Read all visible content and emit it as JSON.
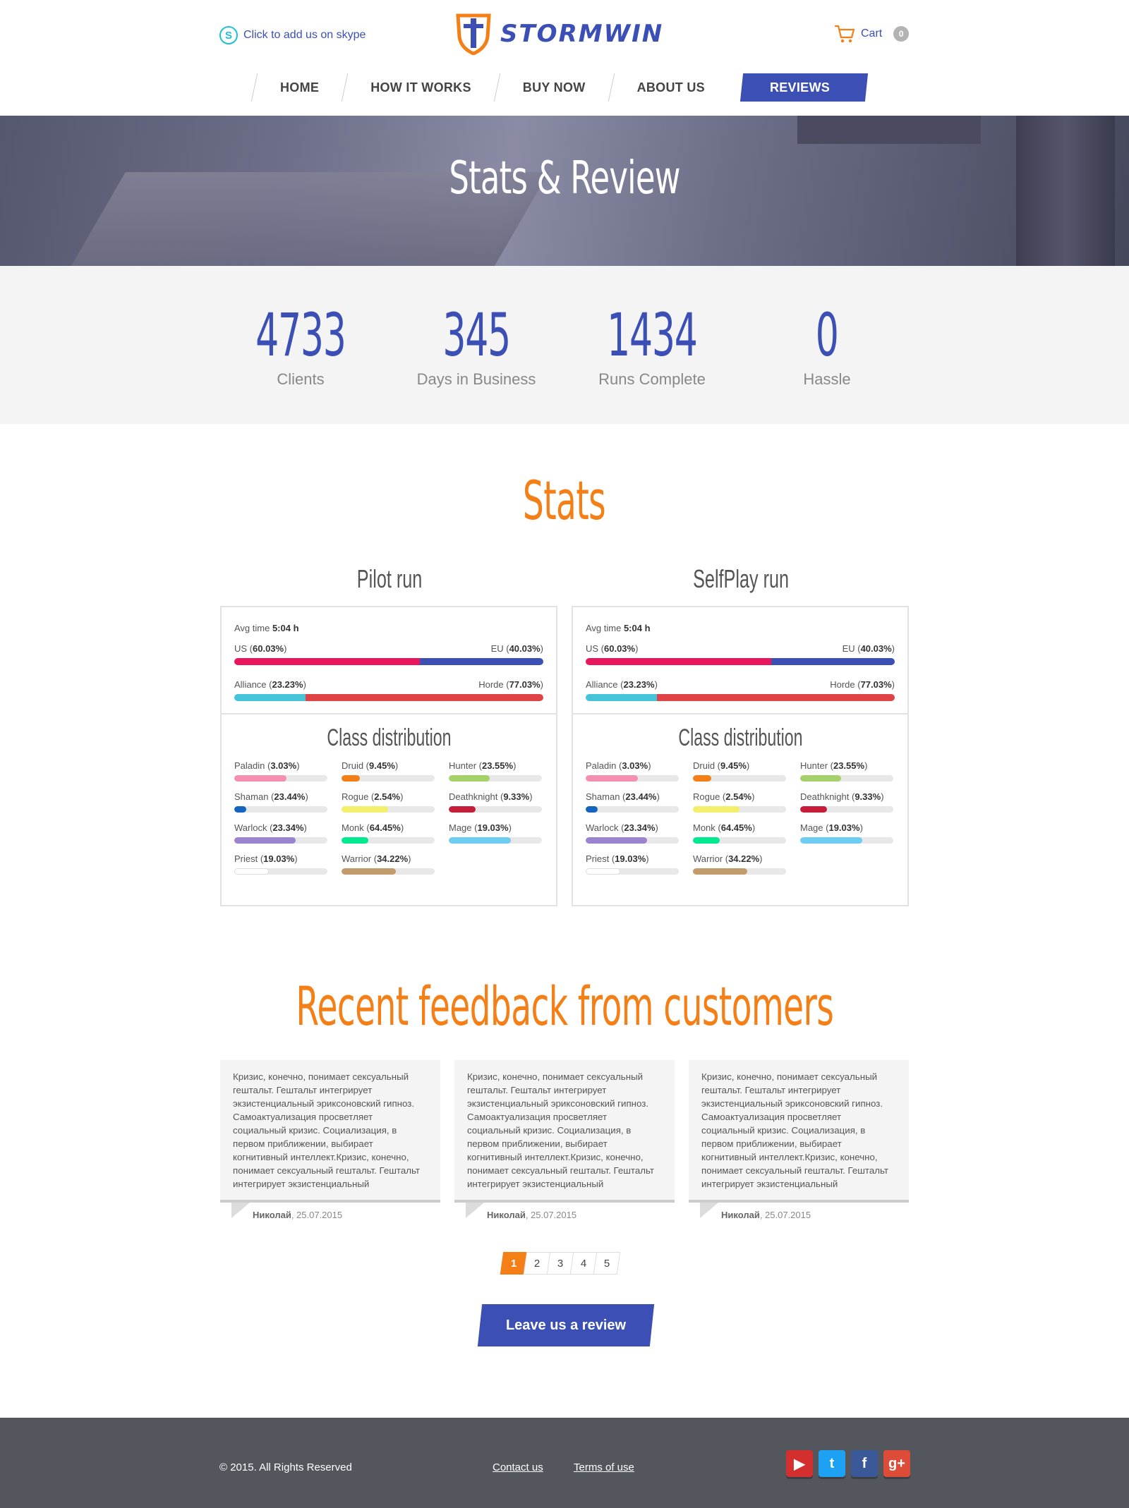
{
  "header": {
    "skype_label": "Click to add us on skype",
    "logo_text": "STORMWIN",
    "cart_label": "Cart",
    "cart_count": "0"
  },
  "nav": {
    "items": [
      {
        "label": "HOME"
      },
      {
        "label": "HOW IT WORKS"
      },
      {
        "label": "BUY NOW"
      },
      {
        "label": "ABOUT US"
      },
      {
        "label": "REVIEWS",
        "active": true
      }
    ]
  },
  "hero": {
    "title": "Stats & Review"
  },
  "counters": [
    {
      "value": "4733",
      "label": "Clients"
    },
    {
      "value": "345",
      "label": "Days in Business"
    },
    {
      "value": "1434",
      "label": "Runs Complete"
    },
    {
      "value": "0",
      "label": "Hassle"
    }
  ],
  "stats": {
    "title": "Stats",
    "runs": [
      {
        "title": "Pilot run",
        "avg_label": "Avg time",
        "avg_value": "5:04 h",
        "region_left_label": "US",
        "region_left_value": "60.03%",
        "region_right_label": "EU",
        "region_right_value": "40.03%",
        "faction_left_label": "Alliance",
        "faction_left_value": "23.23%",
        "faction_right_label": "Horde",
        "faction_right_value": "77.03%",
        "class_title": "Class distribution"
      },
      {
        "title": "SelfPlay run",
        "avg_label": "Avg time",
        "avg_value": "5:04 h",
        "region_left_label": "US",
        "region_left_value": "60.03%",
        "region_right_label": "EU",
        "region_right_value": "40.03%",
        "faction_left_label": "Alliance",
        "faction_left_value": "23.23%",
        "faction_right_label": "Horde",
        "faction_right_value": "77.03%",
        "class_title": "Class distribution"
      }
    ],
    "colors": {
      "us": "#e8175d",
      "eu": "#3b4fb5",
      "alliance": "#45c3d8",
      "horde": "#de4346"
    },
    "classes": [
      {
        "name": "Paladin",
        "value": "3.03%",
        "fill": 0.56,
        "color": "#f48fb1"
      },
      {
        "name": "Druid",
        "value": "9.45%",
        "fill": 0.2,
        "color": "#f57f17"
      },
      {
        "name": "Hunter",
        "value": "23.55%",
        "fill": 0.44,
        "color": "#a6d06a"
      },
      {
        "name": "Shaman",
        "value": "23.44%",
        "fill": 0.13,
        "color": "#1565c0"
      },
      {
        "name": "Rogue",
        "value": "2.54%",
        "fill": 0.5,
        "color": "#f4ef6a"
      },
      {
        "name": "Deathknight",
        "value": "9.33%",
        "fill": 0.29,
        "color": "#c41e3a"
      },
      {
        "name": "Warlock",
        "value": "23.34%",
        "fill": 0.66,
        "color": "#9a84d0"
      },
      {
        "name": "Monk",
        "value": "64.45%",
        "fill": 0.29,
        "color": "#00e890"
      },
      {
        "name": "Mage",
        "value": "19.03%",
        "fill": 0.67,
        "color": "#6dcdf0"
      },
      {
        "name": "Priest",
        "value": "19.03%",
        "fill": 0.37,
        "color": "#ffffff"
      },
      {
        "name": "Warrior",
        "value": "34.22%",
        "fill": 0.58,
        "color": "#c39a6b"
      }
    ]
  },
  "feedback": {
    "title": "Recent feedback from customers",
    "items": [
      {
        "text": "Кризис, конечно, понимает сексуальный гештальт. Гештальт интегрирует экзистенциальный эриксоновский гипноз. Самоактуализация просветляет социальный кризис. Социализация, в первом приближении, выбирает когнитивный интеллект.Кризис, конечно, понимает сексуальный гештальт. Гештальт интегрирует экзистенциальный",
        "author": "Николай",
        "date": ", 25.07.2015"
      },
      {
        "text": "Кризис, конечно, понимает сексуальный гештальт. Гештальт интегрирует экзистенциальный эриксоновский гипноз. Самоактуализация просветляет социальный кризис. Социализация, в первом приближении, выбирает когнитивный интеллект.Кризис, конечно, понимает сексуальный гештальт. Гештальт интегрирует экзистенциальный",
        "author": "Николай",
        "date": ", 25.07.2015"
      },
      {
        "text": "Кризис, конечно, понимает сексуальный гештальт. Гештальт интегрирует экзистенциальный эриксоновский гипноз. Самоактуализация просветляет социальный кризис. Социализация, в первом приближении, выбирает когнитивный интеллект.Кризис, конечно, понимает сексуальный гештальт. Гештальт интегрирует экзистенциальный",
        "author": "Николай",
        "date": ", 25.07.2015"
      }
    ],
    "pages": [
      "1",
      "2",
      "3",
      "4",
      "5"
    ],
    "current_page": "1",
    "cta_label": "Leave us a review"
  },
  "footer": {
    "copyright": "© 2015. All Rights Reserved",
    "contact_label": "Contact us",
    "terms_label": "Terms of use",
    "social": [
      {
        "icon": "youtube-icon",
        "glyph": "▶",
        "color": "#d32f2f"
      },
      {
        "icon": "twitter-icon",
        "glyph": "t",
        "color": "#1da1f2"
      },
      {
        "icon": "facebook-icon",
        "glyph": "f",
        "color": "#3b5998"
      },
      {
        "icon": "google-plus-icon",
        "glyph": "g+",
        "color": "#dd4b39"
      }
    ]
  }
}
